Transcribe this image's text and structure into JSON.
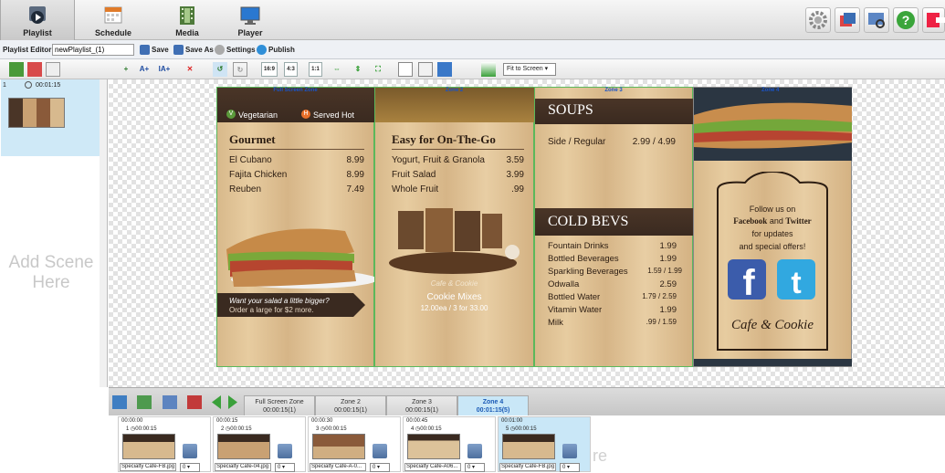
{
  "nav": {
    "tabs": [
      {
        "label": "Playlist",
        "icon": "playlist-icon"
      },
      {
        "label": "Schedule",
        "icon": "schedule-icon"
      },
      {
        "label": "Media",
        "icon": "media-icon"
      },
      {
        "label": "Player",
        "icon": "player-icon"
      }
    ],
    "right_buttons": [
      "settings-gear-icon",
      "display-icon",
      "preview-icon",
      "help-icon",
      "exit-icon"
    ]
  },
  "editor": {
    "label": "Playlist Editor -",
    "playlist_name": "newPlaylist_(1)",
    "save": "Save",
    "save_as": "Save As",
    "settings": "Settings",
    "publish": "Publish"
  },
  "toolbar": {
    "ratio_169": "16:9",
    "ratio_43": "4:3",
    "ratio_11": "1:1",
    "fit": "Fit to Screen"
  },
  "scenes": {
    "items": [
      {
        "number": "1",
        "duration": "00:01:15"
      }
    ],
    "add_label": "Add Scene Here"
  },
  "zones": {
    "z1": {
      "label": "Full Screen Zone",
      "veg": "Vegetarian",
      "hot": "Served Hot",
      "heading": "Gourmet",
      "items": [
        {
          "name": "El Cubano",
          "price": "8.99"
        },
        {
          "name": "Fajita Chicken",
          "price": "8.99"
        },
        {
          "name": "Reuben",
          "price": "7.49"
        }
      ],
      "promo1": "Want your salad a little bigger?",
      "promo2": "Order a large for $2 more."
    },
    "z2": {
      "label": "Zone 2",
      "heading": "Easy for On-The-Go",
      "items": [
        {
          "name": "Yogurt, Fruit & Granola",
          "price": "3.59"
        },
        {
          "name": "Fruit Salad",
          "price": "3.99"
        },
        {
          "name": "Whole Fruit",
          "price": ".99"
        }
      ],
      "brand": "Cafe & Cookie",
      "product": "Cookie Mixes",
      "product_price": "12.00ea / 3 for 33.00"
    },
    "z3": {
      "label": "Zone 3",
      "soups_heading": "SOUPS",
      "soups": [
        {
          "name": "Side / Regular",
          "price": "2.99 / 4.99"
        }
      ],
      "bevs_heading": "COLD BEVS",
      "bevs": [
        {
          "name": "Fountain Drinks",
          "price": "1.99"
        },
        {
          "name": "Bottled Beverages",
          "price": "1.99"
        },
        {
          "name": "Sparkling Beverages",
          "price": "1.59 / 1.99"
        },
        {
          "name": "Odwalla",
          "price": "2.59"
        },
        {
          "name": "Bottled Water",
          "price": "1.79 / 2.59"
        },
        {
          "name": "Vitamin Water",
          "price": "1.99"
        },
        {
          "name": "Milk",
          "price": ".99 / 1.59"
        }
      ]
    },
    "z4": {
      "label": "Zone 4",
      "follow1": "Follow us on",
      "facebook": "Facebook",
      "and": "and",
      "twitter": "Twitter",
      "follow3": "for updates",
      "follow4": "and special offers!",
      "brand": "Cafe & Cookie"
    }
  },
  "bottom": {
    "tabs": [
      {
        "name": "Full Screen Zone",
        "time": "00:00:15(1)"
      },
      {
        "name": "Zone 2",
        "time": "00:00:15(1)"
      },
      {
        "name": "Zone 3",
        "time": "00:00:15(1)"
      },
      {
        "name": "Zone 4",
        "time": "00:01:15(5)"
      }
    ],
    "cards": [
      {
        "start": "00:00:00",
        "num": "1",
        "dur": "00:00:15",
        "file": "Specialty Cafe-FB.jpg",
        "sel": "0"
      },
      {
        "start": "00:00:15",
        "num": "2",
        "dur": "00:00:15",
        "file": "Specialty Cafe-04.jpg",
        "sel": "0"
      },
      {
        "start": "00:00:30",
        "num": "3",
        "dur": "00:00:15",
        "file": "Specialty Cafe-A-0...",
        "sel": "0"
      },
      {
        "start": "00:00:45",
        "num": "4",
        "dur": "00:00:15",
        "file": "Specialty Cafe-A06...",
        "sel": "0"
      },
      {
        "start": "00:01:00",
        "num": "5",
        "dur": "00:00:15",
        "file": "Specialty Cafe-FB.jpg",
        "sel": "0"
      }
    ],
    "ghost": "re"
  }
}
